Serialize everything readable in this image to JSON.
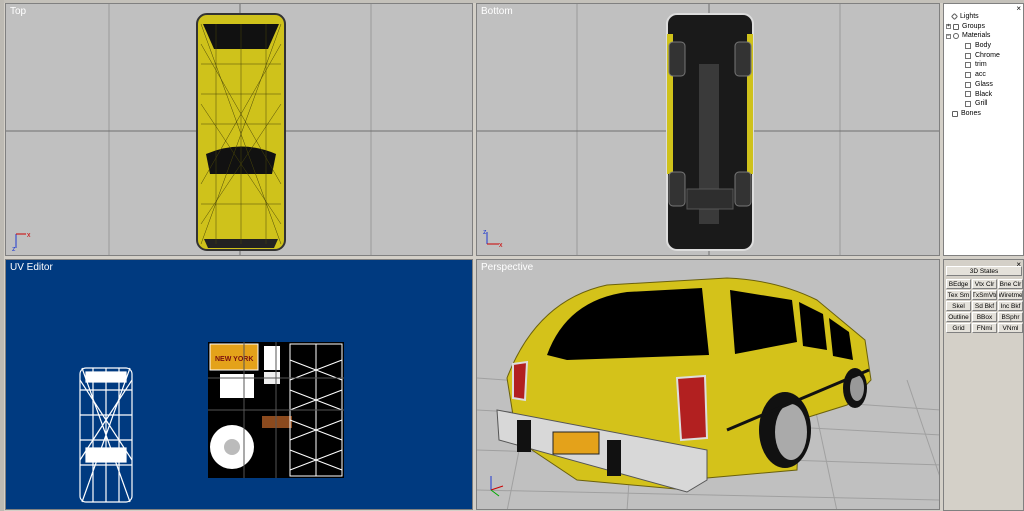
{
  "viewports": {
    "top": {
      "label": "Top"
    },
    "bottom": {
      "label": "Bottom"
    },
    "uv": {
      "label": "UV Editor"
    },
    "perspective": {
      "label": "Perspective"
    }
  },
  "scene_tree": {
    "close": "×",
    "items": [
      {
        "label": "Lights",
        "level": 0,
        "icon": "light-icon"
      },
      {
        "label": "Groups",
        "level": 0,
        "icon": "groups-icon"
      },
      {
        "label": "Materials",
        "level": 0,
        "icon": "materials-icon"
      },
      {
        "label": "Body",
        "level": 1,
        "icon": "material-icon"
      },
      {
        "label": "Chrome",
        "level": 1,
        "icon": "material-icon"
      },
      {
        "label": "trim",
        "level": 1,
        "icon": "material-icon"
      },
      {
        "label": "acc",
        "level": 1,
        "icon": "material-icon"
      },
      {
        "label": "Glass",
        "level": 1,
        "icon": "material-icon"
      },
      {
        "label": "Black",
        "level": 1,
        "icon": "material-icon"
      },
      {
        "label": "Grill",
        "level": 1,
        "icon": "material-icon"
      },
      {
        "label": "Bones",
        "level": 0,
        "icon": "bones-icon"
      }
    ]
  },
  "states_panel": {
    "close": "×",
    "title": "3D States",
    "buttons": [
      [
        "BEdge",
        "Vtx Clr",
        "Bne Clr"
      ],
      [
        "Tex Sm",
        "TxSmVtr",
        "Wiretme"
      ],
      [
        "Skel",
        "Sd Bkf",
        "Inc Bkf"
      ],
      [
        "Outline",
        "BBox",
        "BSphr"
      ],
      [
        "Grid",
        "FNmi",
        "VNml"
      ]
    ]
  },
  "colors": {
    "viewport_bg": "#c0c0c0",
    "uv_bg": "#003a80",
    "car_body": "#d4c21a",
    "grid_line": "#808080"
  },
  "texture": {
    "plate_text": "NEW YORK"
  }
}
